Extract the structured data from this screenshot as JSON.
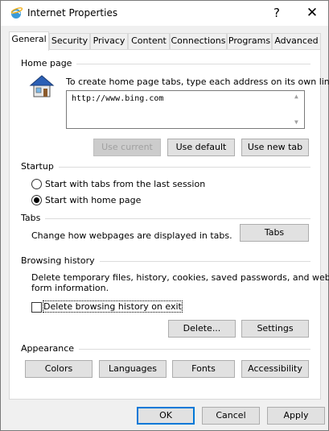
{
  "window": {
    "title": "Internet Properties",
    "help_label": "?",
    "close_label": "✕"
  },
  "tabs": [
    {
      "label": "General"
    },
    {
      "label": "Security"
    },
    {
      "label": "Privacy"
    },
    {
      "label": "Content"
    },
    {
      "label": "Connections"
    },
    {
      "label": "Programs"
    },
    {
      "label": "Advanced"
    }
  ],
  "home_page": {
    "group_label": "Home page",
    "instruction": "To create home page tabs, type each address on its own line.",
    "url_value": "http://www.bing.com",
    "use_current_label": "Use current",
    "use_default_label": "Use default",
    "use_new_tab_label": "Use new tab"
  },
  "startup": {
    "group_label": "Startup",
    "option_last_session": "Start with tabs from the last session",
    "option_home_page": "Start with home page",
    "selected": "option_home_page"
  },
  "tabs_group": {
    "group_label": "Tabs",
    "description": "Change how webpages are displayed in tabs.",
    "button_label": "Tabs"
  },
  "browsing_history": {
    "group_label": "Browsing history",
    "description_line1": "Delete temporary files, history, cookies, saved passwords, and web",
    "description_line2": "form information.",
    "delete_on_exit_label": "Delete browsing history on exit",
    "delete_on_exit_checked": false,
    "delete_button_label": "Delete...",
    "settings_button_label": "Settings"
  },
  "appearance": {
    "group_label": "Appearance",
    "colors_label": "Colors",
    "languages_label": "Languages",
    "fonts_label": "Fonts",
    "accessibility_label": "Accessibility"
  },
  "footer": {
    "ok_label": "OK",
    "cancel_label": "Cancel",
    "apply_label": "Apply"
  },
  "colors": {
    "accent": "#0078d7",
    "disabled_text": "#a0a0a0"
  }
}
